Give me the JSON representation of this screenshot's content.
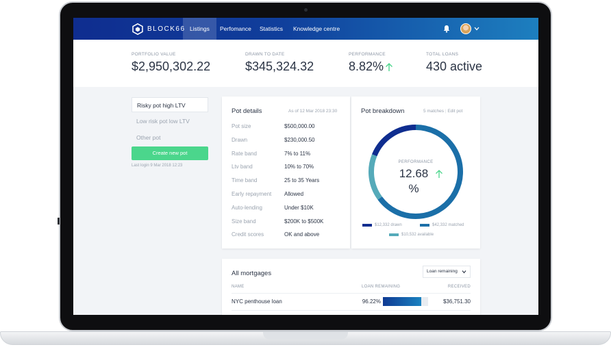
{
  "colors": {
    "nav_start": "#0f2d8f",
    "nav_end": "#1d7fbf",
    "accent_green": "#4bd68c",
    "donut_dark": "#0f2d8f",
    "donut_mid": "#1b6fa8",
    "donut_light": "#55aab9"
  },
  "nav": {
    "brand": "BLOCK66",
    "items": [
      "Listings",
      "Perfomance",
      "Statistics",
      "Knowledge centre"
    ],
    "active": "Listings",
    "icons": [
      "block66-logo-icon",
      "bell-icon",
      "user-avatar",
      "chevron-down-icon"
    ]
  },
  "stats": [
    {
      "label": "PORTFOLIO VALUE",
      "value": "$2,950,302.22"
    },
    {
      "label": "DRAWN TO DATE",
      "value": "$345,324.32"
    },
    {
      "label": "PERFORMANCE",
      "value": "8.82%",
      "trend": "up"
    },
    {
      "label": "TOTAL LOANS",
      "value": "430 active"
    }
  ],
  "pots": {
    "items": [
      "Risky pot high LTV",
      "Low risk pot low LTV",
      "Other pot"
    ],
    "active_index": 0,
    "create_label": "Create new pot",
    "last_login": "Last login 9 Mar 2018 12:23"
  },
  "pot_details": {
    "title": "Pot details",
    "as_of": "As of 12 Mar 2018 23:30",
    "rows": [
      {
        "label": "Pot size",
        "value": "$500,000.00"
      },
      {
        "label": "Drawn",
        "value": "$230,000.50"
      },
      {
        "label": "Rate band",
        "value": "7% to 11%"
      },
      {
        "label": "Ltv band",
        "value": "10% to 70%"
      },
      {
        "label": "Time band",
        "value": "25 to 35 Years"
      },
      {
        "label": "Early repayment",
        "value": "Allowed"
      },
      {
        "label": "Auto-lending",
        "value": "Under $10K"
      },
      {
        "label": "Size band",
        "value": "$200K to $500K"
      },
      {
        "label": "Credit scores",
        "value": "OK and above"
      }
    ]
  },
  "pot_breakdown": {
    "title": "Pot breakdown",
    "matches": "5 matches",
    "edit_label": "Edit pot",
    "performance_label": "PERFORMANCE",
    "performance_value": "12.68",
    "performance_unit": "%",
    "legend": [
      {
        "label": "$12,332 drawn",
        "color": "#0f2d8f",
        "amount": 12332
      },
      {
        "label": "$42,332 matched",
        "color": "#1b6fa8",
        "amount": 42332
      },
      {
        "label": "$10,532 available",
        "color": "#55aab9",
        "amount": 10532
      }
    ]
  },
  "mortgages": {
    "title": "All mortgages",
    "sort_label": "Loan remaining",
    "columns": [
      "NAME",
      "LOAN REMAINING",
      "RECEIVED"
    ],
    "rows": [
      {
        "name": "NYC penthouse loan",
        "remaining": "96.22%",
        "remaining_fraction": 0.9622,
        "received": "$36,751.30"
      }
    ]
  }
}
